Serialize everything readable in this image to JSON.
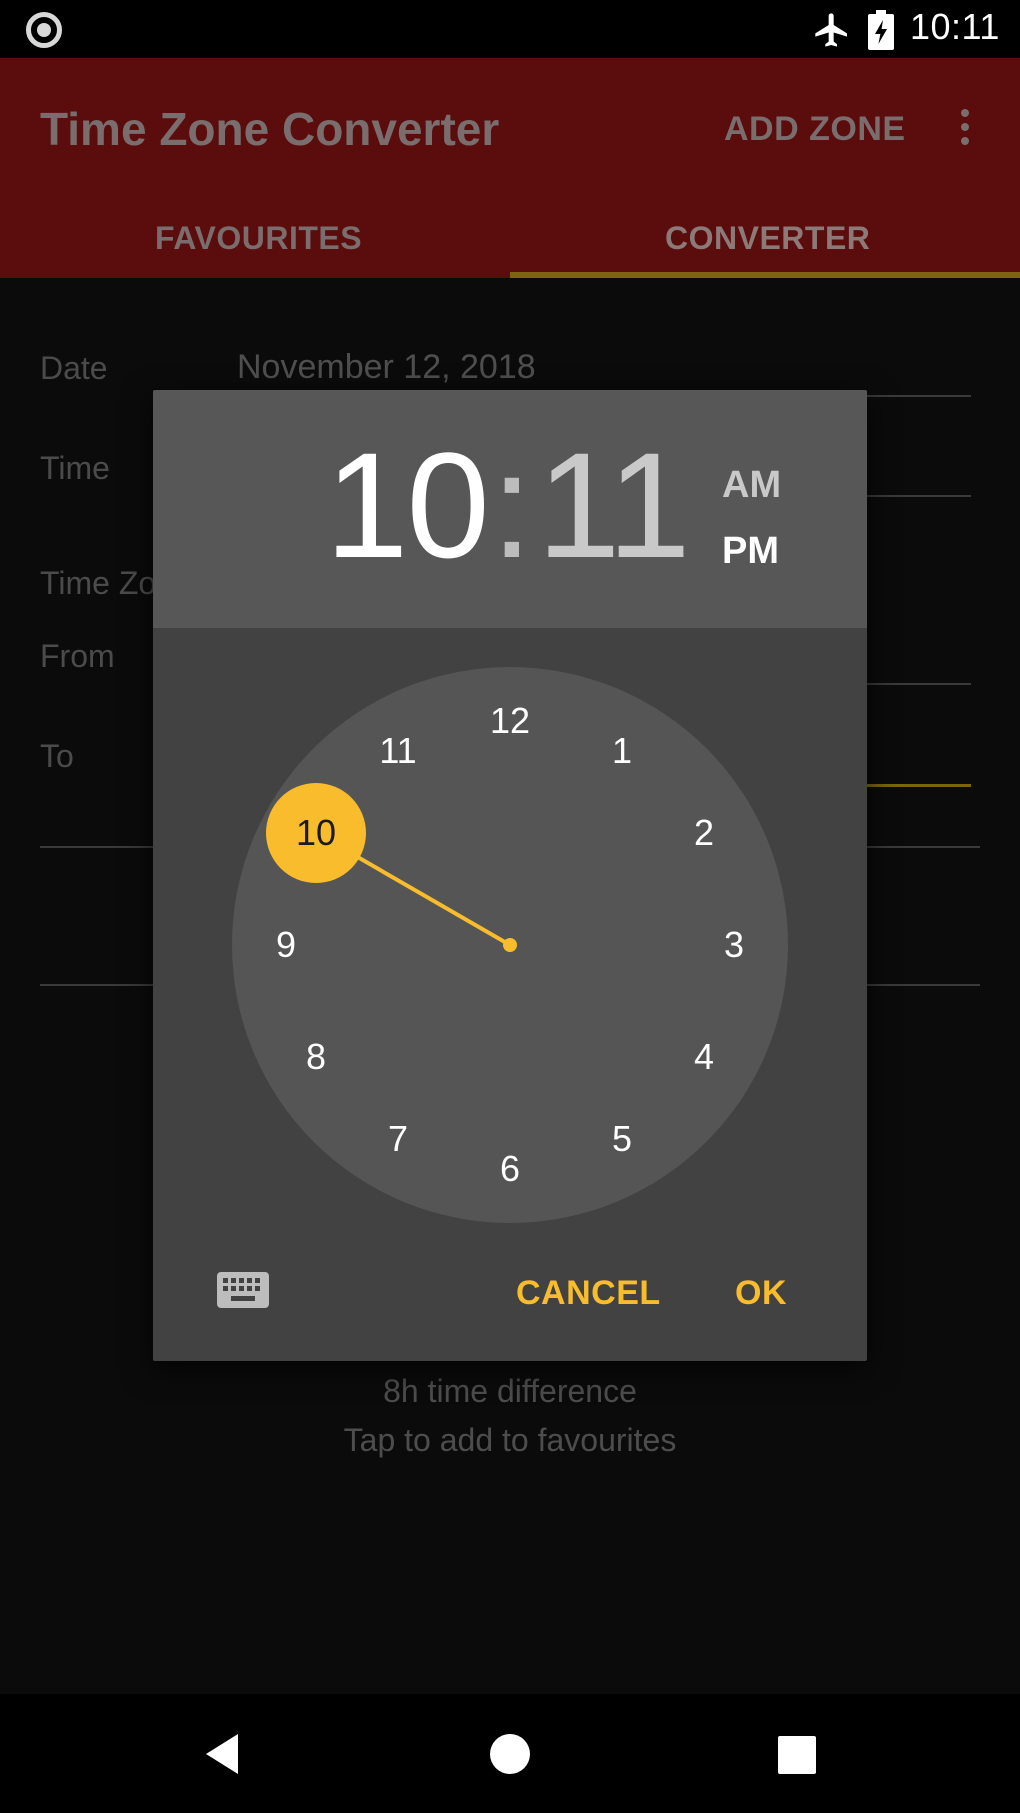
{
  "status_bar": {
    "time": "10:11"
  },
  "app_bar": {
    "title": "Time Zone Converter",
    "add_zone_label": "ADD ZONE",
    "tabs": [
      {
        "label": "FAVOURITES",
        "selected": false
      },
      {
        "label": "CONVERTER",
        "selected": true
      }
    ]
  },
  "form": {
    "date_label": "Date",
    "date_value": "November 12, 2018",
    "time_label": "Time",
    "time_zone_label": "Time Zo",
    "from_label": "From",
    "to_label": "To",
    "time_difference": "8h time difference",
    "tap_hint": "Tap to add to favourites"
  },
  "time_picker": {
    "hour": "10",
    "separator": ":",
    "minute": "11",
    "am_label": "AM",
    "pm_label": "PM",
    "selected_period": "PM",
    "selected_hour": 10,
    "clock_numbers": [
      "12",
      "1",
      "2",
      "3",
      "4",
      "5",
      "6",
      "7",
      "8",
      "9",
      "10",
      "11"
    ],
    "cancel_label": "CANCEL",
    "ok_label": "OK",
    "accent_color": "#F9BC2D"
  },
  "colors": {
    "app_bar": "#5B0C0D",
    "dialog_header": "#575757",
    "dialog_body": "#424242",
    "clock_face": "#555555"
  }
}
